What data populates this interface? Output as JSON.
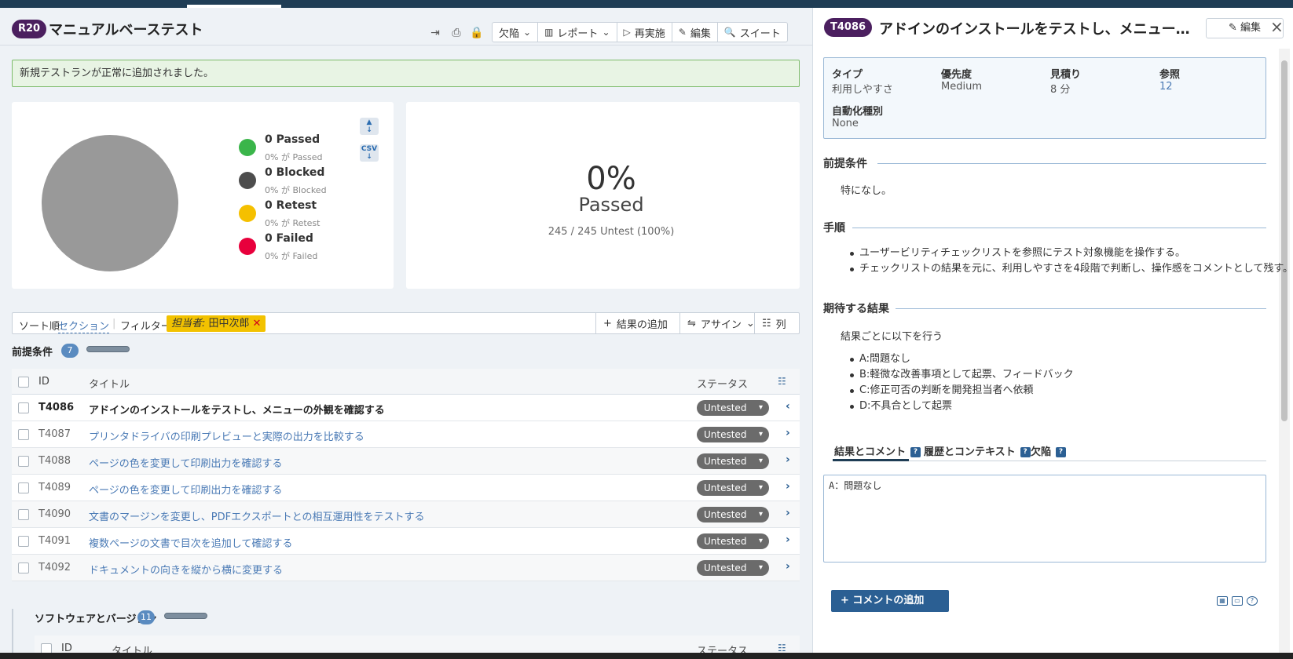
{
  "run": {
    "badge": "R20",
    "title": "マニュアルベーステスト",
    "toolbar": {
      "defects": "欠陥",
      "report": "レポート",
      "rerun": "再実施",
      "edit": "編集",
      "suite": "スイート"
    },
    "success_message": "新規テストランが正常に追加されました。"
  },
  "stats": {
    "legend": [
      {
        "label": "0 Passed",
        "sub": "0% が Passed",
        "color": "#3ab54a"
      },
      {
        "label": "0 Blocked",
        "sub": "0% が Blocked",
        "color": "#4d4d4d"
      },
      {
        "label": "0 Retest",
        "sub": "0% が Retest",
        "color": "#f5c000"
      },
      {
        "label": "0 Failed",
        "sub": "0% が Failed",
        "color": "#e8003c"
      }
    ],
    "csv_label": "CSV",
    "percent": "0%",
    "percent_label": "Passed",
    "count_text": "245 / 245 Untest (100%)"
  },
  "filter": {
    "sort_label": "ソート順:",
    "sort_value": "セクション",
    "filter_label": "フィルター:",
    "chip_key": "担当者:",
    "chip_value": "田中次郎",
    "add_result": "結果の追加",
    "assign": "アサイン",
    "columns": "列"
  },
  "section1": {
    "title": "前提条件",
    "count": "7",
    "columns": {
      "id": "ID",
      "title": "タイトル",
      "status": "ステータス"
    },
    "rows": [
      {
        "id": "T4086",
        "title": "アドインのインストールをテストし、メニューの外観を確認する",
        "status": "Untested"
      },
      {
        "id": "T4087",
        "title": "プリンタドライバの印刷プレビューと実際の出力を比較する",
        "status": "Untested"
      },
      {
        "id": "T4088",
        "title": "ページの色を変更して印刷出力を確認する",
        "status": "Untested"
      },
      {
        "id": "T4089",
        "title": "ページの色を変更して印刷出力を確認する",
        "status": "Untested"
      },
      {
        "id": "T4090",
        "title": "文書のマージンを変更し、PDFエクスポートとの相互運用性をテストする",
        "status": "Untested"
      },
      {
        "id": "T4091",
        "title": "複数ページの文書で目次を追加して確認する",
        "status": "Untested"
      },
      {
        "id": "T4092",
        "title": "ドキュメントの向きを縦から横に変更する",
        "status": "Untested"
      }
    ]
  },
  "section2": {
    "title": "ソフトウェアとバージョン",
    "count": "11",
    "columns": {
      "id": "ID",
      "title": "タイトル",
      "status": "ステータス"
    }
  },
  "case": {
    "badge": "T4086",
    "title": "アドインのインストールをテストし、メニューの外観を確...",
    "edit": "編集",
    "info": {
      "type_label": "タイプ",
      "type_value": "利用しやすさ",
      "priority_label": "優先度",
      "priority_value": "Medium",
      "estimate_label": "見積り",
      "estimate_value": "8 分",
      "ref_label": "参照",
      "ref_value": "12",
      "automation_label": "自動化種別",
      "automation_value": "None"
    },
    "preconditions_head": "前提条件",
    "preconditions_text": "特になし。",
    "steps_head": "手順",
    "steps": [
      "ユーザービリティチェックリストを参照にテスト対象機能を操作する。",
      "チェックリストの結果を元に、利用しやすさを4段階で判断し、操作感をコメントとして残す。"
    ],
    "expected_head": "期待する結果",
    "expected_intro": "結果ごとに以下を行う",
    "expected": [
      "A:問題なし",
      "B:軽微な改善事項として起票、フィードバック",
      "C:修正可否の判断を開発担当者へ依頼",
      "D:不具合として起票"
    ],
    "tabs": [
      "結果とコメント",
      "履歴とコンテキスト",
      "欠陥"
    ],
    "comment_value": "A：問題なし",
    "add_comment": "コメントの追加"
  }
}
